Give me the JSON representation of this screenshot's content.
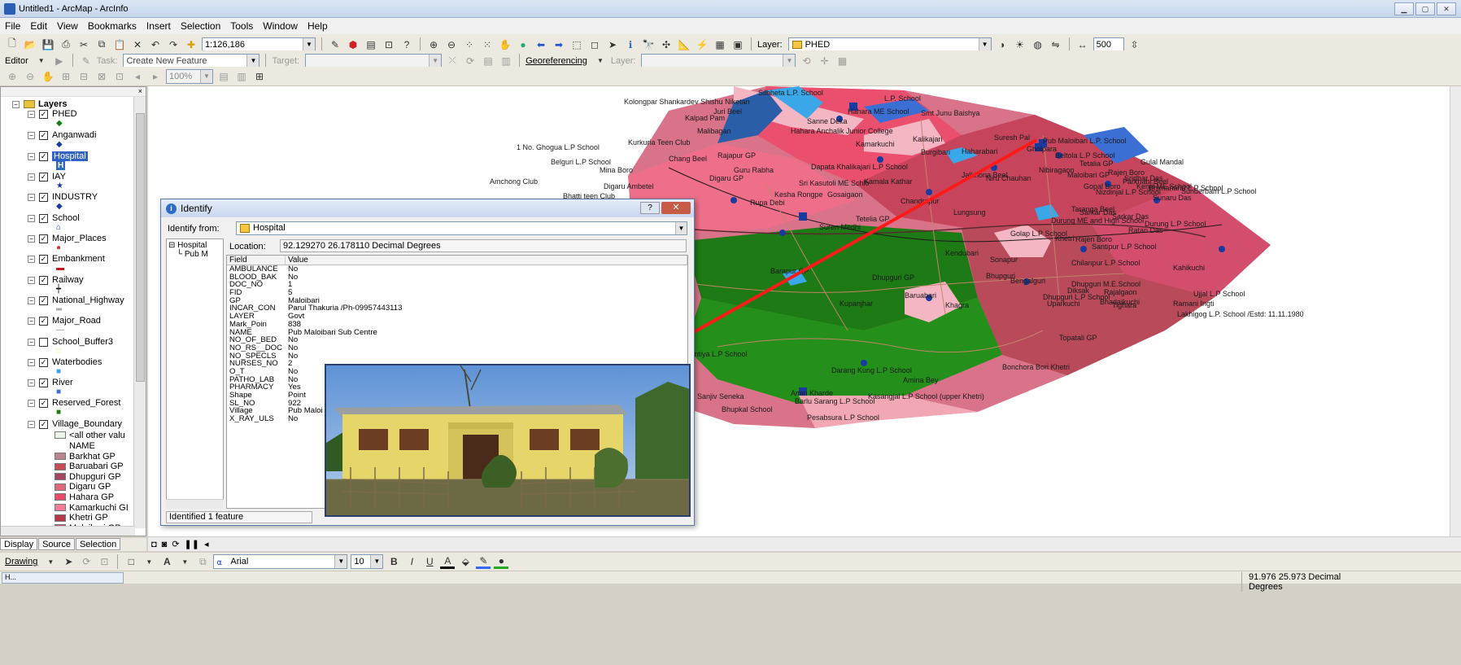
{
  "window": {
    "title": "Untitled1 - ArcMap - ArcInfo"
  },
  "menu": [
    "File",
    "Edit",
    "View",
    "Bookmarks",
    "Insert",
    "Selection",
    "Tools",
    "Window",
    "Help"
  ],
  "toolbar1": {
    "scale": "1:126,186",
    "layer_label": "Layer:",
    "layer_value": "PHED",
    "distance": "500"
  },
  "toolbar2": {
    "editor": "Editor",
    "task_label": "Task:",
    "task_value": "Create New Feature",
    "target_label": "Target:",
    "georef": "Georeferencing",
    "layer_label": "Layer:"
  },
  "toolbar3": {
    "zoom": "100%"
  },
  "toc": {
    "root": "Layers",
    "layers": [
      {
        "name": "PHED",
        "checked": true,
        "symbol": "◆"
      },
      {
        "name": "Anganwadi",
        "checked": true,
        "symbol": "◆"
      },
      {
        "name": "Hospital",
        "checked": true,
        "symbol": "H"
      },
      {
        "name": "IAY",
        "checked": true,
        "symbol": "★"
      },
      {
        "name": "INDUSTRY",
        "checked": true,
        "symbol": "◆"
      },
      {
        "name": "School",
        "checked": true,
        "symbol": "⌂"
      },
      {
        "name": "Major_Places",
        "checked": true,
        "symbol": "●"
      },
      {
        "name": "Embankment",
        "checked": true,
        "symbol": "▬"
      },
      {
        "name": "Railway",
        "checked": true,
        "symbol": "┿"
      },
      {
        "name": "National_Highway",
        "checked": true,
        "symbol": "═"
      },
      {
        "name": "Major_Road",
        "checked": true,
        "symbol": "—"
      },
      {
        "name": "School_Buffer3",
        "checked": false,
        "symbol": "□"
      },
      {
        "name": "Waterbodies",
        "checked": true,
        "symbol": "■"
      },
      {
        "name": "River",
        "checked": true,
        "symbol": "■"
      },
      {
        "name": "Reserved_Forest",
        "checked": true,
        "symbol": "■"
      },
      {
        "name": "Village_Boundary",
        "checked": true,
        "symbol": ""
      }
    ],
    "legend_other": "<all other valu",
    "legend_field": "NAME",
    "legend": [
      {
        "name": "Barkhat GP",
        "color": "#b8858f"
      },
      {
        "name": "Baruabari GP",
        "color": "#c64a5a"
      },
      {
        "name": "Dhupguri GP",
        "color": "#a34760"
      },
      {
        "name": "Digaru GP",
        "color": "#e0687d"
      },
      {
        "name": "Hahara GP",
        "color": "#e94a6a"
      },
      {
        "name": "Kamarkuchi GI",
        "color": "#f07c96"
      },
      {
        "name": "Khetri GP",
        "color": "#b33a4a"
      },
      {
        "name": "Maloibari GP",
        "color": "#c4506a"
      }
    ],
    "tabs": [
      "Display",
      "Source",
      "Selection"
    ]
  },
  "identify": {
    "title": "Identify",
    "from_label": "Identify from:",
    "from_value": "Hospital",
    "tree_root": "Hospital",
    "tree_child": "Pub M",
    "location_label": "Location:",
    "location_value": "92.129270  26.178110 Decimal Degrees",
    "col_field": "Field",
    "col_value": "Value",
    "rows": [
      {
        "f": "AMBULANCE",
        "v": "No"
      },
      {
        "f": "BLOOD_BAK",
        "v": "No"
      },
      {
        "f": "DOC_NO",
        "v": "1"
      },
      {
        "f": "FID",
        "v": "5"
      },
      {
        "f": "GP",
        "v": "Maloibari"
      },
      {
        "f": "INCAR_CON",
        "v": "Parul Thakuria /Ph-09957443113"
      },
      {
        "f": "LAYER",
        "v": "Govt"
      },
      {
        "f": "Mark_Poin",
        "v": "838"
      },
      {
        "f": "NAME",
        "v": "Pub Maloibari Sub Centre"
      },
      {
        "f": "NO_OF_BED",
        "v": "No"
      },
      {
        "f": "NO_RS__DOC",
        "v": "No"
      },
      {
        "f": "NO_SPECLS",
        "v": "No"
      },
      {
        "f": "NURSES_NO",
        "v": "2"
      },
      {
        "f": "O_T",
        "v": "No"
      },
      {
        "f": "PATHO_LAB",
        "v": "No"
      },
      {
        "f": "PHARMACY",
        "v": "Yes"
      },
      {
        "f": "Shape",
        "v": "Point"
      },
      {
        "f": "SL_NO",
        "v": "922"
      },
      {
        "f": "Village",
        "v": "Pub Maloi"
      },
      {
        "f": "X_RAY_ULS",
        "v": "No"
      }
    ],
    "status": "Identified 1 feature"
  },
  "map_labels": [
    "Kolongpar Shankardev Shishu Niketan",
    "Silbheta L.P. School",
    "L.P. School",
    "Juri Beel",
    "Kalpad Pam",
    "Sanne Deka",
    "Smt Junu Baishya",
    "1 No. Ghogua L.P School",
    "Kurkuria Teen Club",
    "Malibagan",
    "Hahara Anchalik Junior College",
    "Suresh Pal",
    "Pub Maloibari L.P. School",
    "Gholpara",
    "Belguri L.P School",
    "Chang Beel",
    "Rajapur GP",
    "Guru Rabha",
    "Dapata Khalikajari L.P School",
    "Beltola L.P School",
    "Gulal Mandal",
    "Mina Boro",
    "Digaru GP",
    "Sri Kasutoli ME Schlo",
    "Kamala Kathar",
    "Jalkhona Beel",
    "Niru Chauhan",
    "Maloibari GP",
    "Sridhar Das",
    "Sunderbam L.P School",
    "Amchong Club",
    "Digaru Ambetel",
    "Kesha Rongpe",
    "Gosaigaon",
    "Sunaru Das",
    "Bhatti teen Club",
    "Rupa Debi",
    "Chandrapur",
    "Tetelia GP",
    "Lungsung",
    "Sarkar Das",
    "Durung ME and High School",
    "Durung L.P School",
    "Ratan Das",
    "Suren Medhi",
    "Golap L.P School",
    "Khetri",
    "Rajen Boro",
    "Santipur L.P School",
    "Kendubari",
    "Sonapur",
    "Kahikuchi",
    "Barapur GP",
    "Dhupguri GP",
    "Bhupguri",
    "Bengalguri",
    "Dhupguri M.E.School",
    "Rajalgaon",
    "Diksak",
    "Baruabari",
    "Dhupguri L.P School",
    "Bhadaikuchi",
    "Kupanjhar",
    "Khagra",
    "Ramani Ingti",
    "Tighara",
    "Uparkuchi",
    "Lakhigog L.P. School /Estd: 11.11.1980",
    "Topatali GP",
    "Darang Kung L.P School",
    "Amina Bey",
    "Amin Kharde",
    "Barlu Sarang L.P School",
    "Bhupkal School",
    "Pesabsura L.P School",
    "Kasangjal L.P School (upper Khetri)",
    "Jaintiya L.P School",
    "Sanjiv Seneka",
    "Hahara ME School",
    "Kamarkuchi",
    "Kalikajari",
    "Burgibari",
    "Haharabari",
    "Tetalia GP",
    "Gopal Boro",
    "Nizdinjal L.P School",
    "Taranga Beel",
    "Sarkar Das",
    "Rajen Boro",
    "Parkhabi Beel",
    "Kenjil ME School",
    "Ujjal L.P School",
    "Bhimanand L.P School",
    "Chilanpur L.P School",
    "Nibiragaon",
    "Bonchora Bori Khetri"
  ],
  "drawing": {
    "label": "Drawing",
    "font": "Arial",
    "size": "10"
  },
  "status": {
    "coords": "91.976  25.973 Decimal Degrees",
    "task": "H..."
  },
  "colors": {
    "accent": "#2d6bc4",
    "arrow": "#ff1a1a"
  }
}
